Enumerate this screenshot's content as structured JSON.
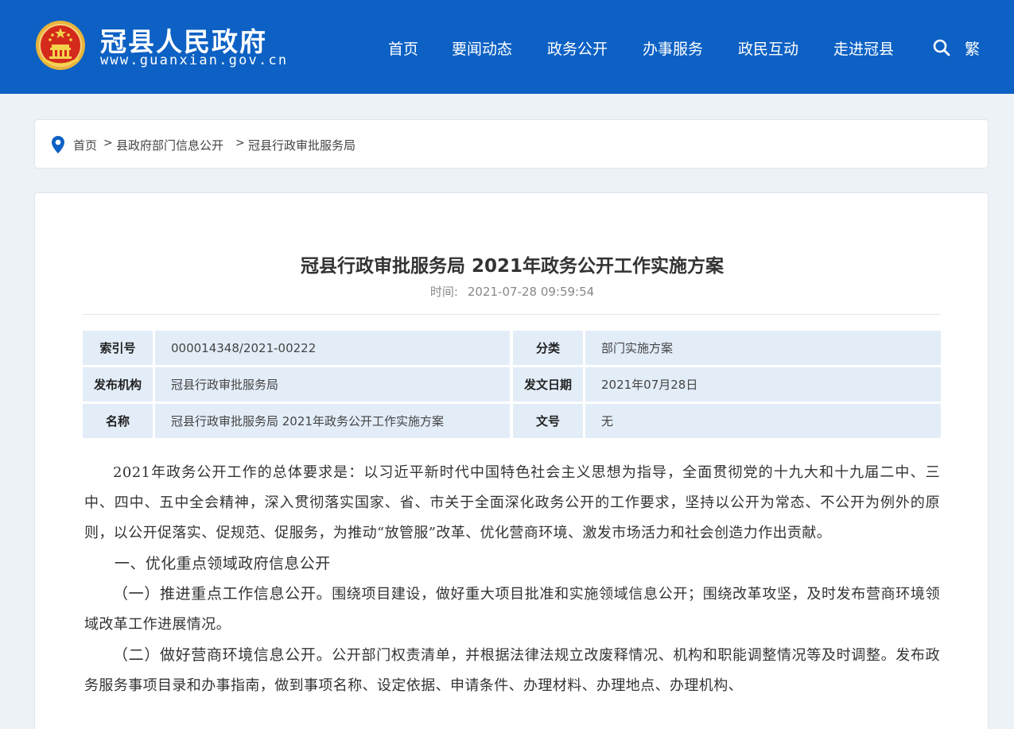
{
  "header": {
    "site_title": "冠县人民政府",
    "site_url": "www.guanxian.gov.cn",
    "nav": [
      "首页",
      "要闻动态",
      "政务公开",
      "办事服务",
      "政民互动",
      "走进冠县"
    ],
    "traditional_label": "繁",
    "brand_color": "#0d61c4"
  },
  "breadcrumb": {
    "items": [
      "首页",
      "县政府部门信息公开",
      "冠县行政审批服务局"
    ],
    "separator": ">"
  },
  "article": {
    "title": "冠县行政审批服务局 2021年政务公开工作实施方案",
    "time_label": "时间:",
    "time_value": "2021-07-28 09:59:54"
  },
  "meta": {
    "rows": [
      {
        "key1": "索引号",
        "val1": "000014348/2021-00222",
        "key2": "分类",
        "val2": "部门实施方案"
      },
      {
        "key1": "发布机构",
        "val1": "冠县行政审批服务局",
        "key2": "发文日期",
        "val2": "2021年07月28日"
      },
      {
        "key1": "名称",
        "val1": "冠县行政审批服务局 2021年政务公开工作实施方案",
        "key2": "文号",
        "val2": "无"
      }
    ]
  },
  "body": {
    "p1": "2021年政务公开工作的总体要求是：以习近平新时代中国特色社会主义思想为指导，全面贯彻党的十九大和十九届二中、三中、四中、五中全会精神，深入贯彻落实国家、省、市关于全面深化政务公开的工作要求，坚持以公开为常态、不公开为例外的原则，以公开促落实、促规范、促服务，为推动“放管服”改革、优化营商环境、激发市场活力和社会创造力作出贡献。",
    "h1": "一、优化重点领域政府信息公开",
    "s1_lead": "（一）推进重点工作信息公开。",
    "s1_text": "围绕项目建设，做好重大项目批准和实施领域信息公开；围绕改革攻坚，及时发布营商环境领域改革工作进展情况。",
    "s2_lead": "（二）做好营商环境信息公开。",
    "s2_text": "公开部门权责清单，并根据法律法规立改废释情况、机构和职能调整情况等及时调整。发布政务服务事项目录和办事指南，做到事项名称、设定依据、申请条件、办理材料、办理地点、办理机构、"
  }
}
